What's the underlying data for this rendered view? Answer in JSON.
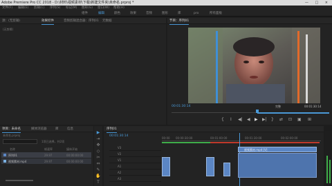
{
  "title_bar": {
    "title": "Adobe Premiere Pro CC 2018 - D:\\材料\\视频素材\\下载\\新建文件夹\\未命名.prproj *",
    "controls": "— □ ×"
  },
  "menu": [
    "文件(F)",
    "编辑(E)",
    "剪辑(C)",
    "序列(S)",
    "标记(M)",
    "图形(G)",
    "窗口(W)",
    "帮助(H)"
  ],
  "workspaces": [
    "组件",
    "编辑",
    "颜色",
    "效果",
    "音频",
    "图形",
    "库",
    "pro",
    "所有面板"
  ],
  "active_workspace": "编辑",
  "left_top_tabs": [
    "源：(无剪辑)",
    "效果控件",
    "音频剪辑混合器：序列01",
    "元数据"
  ],
  "left_top_small": "(无剪辑)",
  "program": {
    "title": "节目：序列01",
    "timecode": "00:01:30:14",
    "fit": "完整",
    "duration": "00:01:30:14",
    "controls": [
      "{",
      "I",
      "◀|",
      "◀",
      "▶",
      "▶|",
      "}",
      "⇄",
      "⊡",
      "▣",
      "⊞"
    ]
  },
  "project": {
    "tabs": [
      "项目：未命名",
      "媒体浏览器",
      "库",
      "信息"
    ],
    "path": "未命名.prproj",
    "count": "1项已选择，共2项",
    "cols": [
      "名称",
      "帧速率",
      "媒体开始"
    ],
    "items": [
      {
        "name": "序列01",
        "fps": "29.97",
        "start": "00:00:00:00"
      },
      {
        "name": "视频素材.mp4",
        "fps": "29.97",
        "start": "00:00:00:00"
      }
    ]
  },
  "timeline": {
    "tab": "序列01",
    "timecode": "00:01:30:14",
    "ruler": [
      "00:00",
      "00:00:30:00",
      "00:01:00:00",
      "00:01:30:00",
      "00:02:00:00"
    ],
    "tracks": [
      "V3",
      "V2",
      "V1",
      "A1",
      "A2",
      "A3"
    ],
    "clip_label": "视频素材.mp4 [V]"
  },
  "tools": [
    "▶",
    "⇥",
    "✥",
    "◇",
    "✂",
    "⇔",
    "✎",
    "✋",
    "T"
  ],
  "colors": {
    "accent": "#4a9ad8",
    "clip": "#5b86c4",
    "playhead": "#4a9ad8"
  }
}
